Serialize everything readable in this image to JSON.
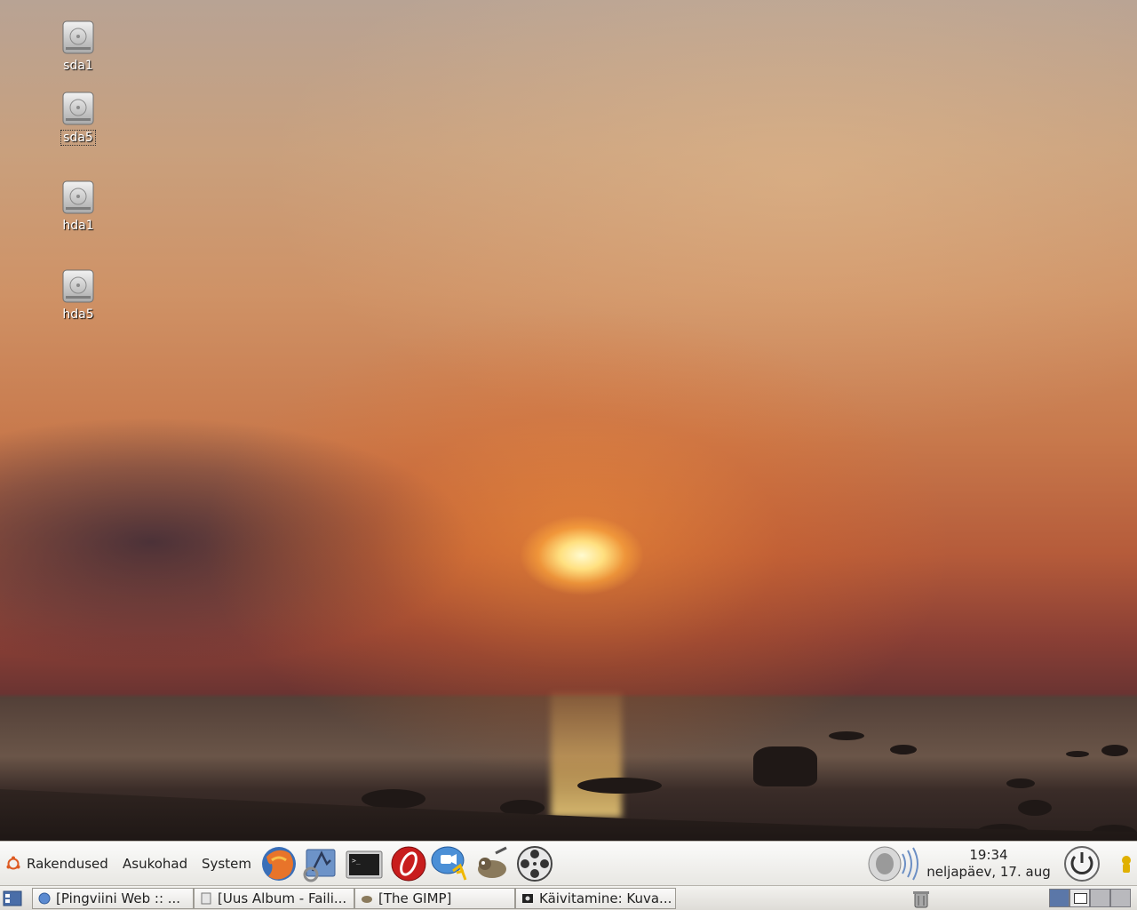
{
  "desktop": {
    "icons": [
      {
        "label": "sda1",
        "selected": false
      },
      {
        "label": "sda5",
        "selected": true
      },
      {
        "label": "hda1",
        "selected": false
      },
      {
        "label": "hda5",
        "selected": false
      }
    ]
  },
  "top_panel": {
    "menus": [
      "Rakendused",
      "Asukohad",
      "System"
    ],
    "launchers": [
      "firefox-icon",
      "mail-client-icon",
      "terminal-icon",
      "media-player-icon",
      "messenger-icon",
      "gimp-icon",
      "video-player-icon"
    ],
    "clock": {
      "time": "19:34",
      "date": "neljapäev, 17. aug"
    }
  },
  "bottom_panel": {
    "tasks": [
      {
        "label": "[Pingviini Web :: ...",
        "icon": "web-browser-icon"
      },
      {
        "label": "[Uus Album - Faili...",
        "icon": "document-icon"
      },
      {
        "label": "[The GIMP]",
        "icon": "gimp-small-icon"
      },
      {
        "label": "Käivitamine: Kuva...",
        "icon": "terminal-small-icon"
      }
    ]
  },
  "colors": {
    "accent": "#4a6ea8",
    "panel": "#eeede9"
  }
}
